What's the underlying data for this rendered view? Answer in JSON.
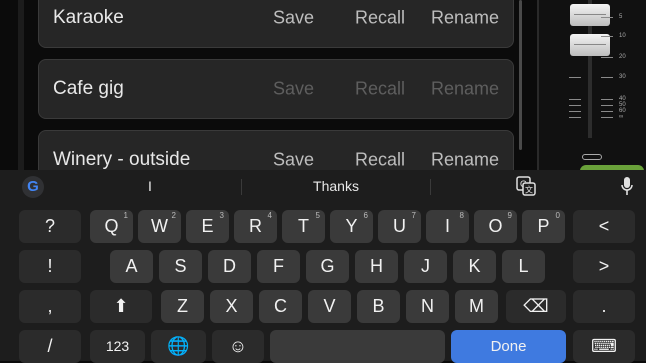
{
  "presets": [
    {
      "name": "Karaoke",
      "save": "Save",
      "recall": "Recall",
      "rename": "Rename",
      "dim": false
    },
    {
      "name": "Cafe gig",
      "save": "Save",
      "recall": "Recall",
      "rename": "Rename",
      "dim": true
    },
    {
      "name": "Winery - outside",
      "save": "Save",
      "recall": "Recall",
      "rename": "Rename",
      "dim": false
    }
  ],
  "fader_scale": [
    "5",
    "10",
    "20",
    "30",
    "40",
    "50",
    "60",
    "∞"
  ],
  "keyboard": {
    "suggestions": [
      "I",
      "Thanks",
      ""
    ],
    "row1": [
      {
        "label": "?",
        "hint": ""
      },
      {
        "label": "Q",
        "hint": "1"
      },
      {
        "label": "W",
        "hint": "2"
      },
      {
        "label": "E",
        "hint": "3"
      },
      {
        "label": "R",
        "hint": "4"
      },
      {
        "label": "T",
        "hint": "5"
      },
      {
        "label": "Y",
        "hint": "6"
      },
      {
        "label": "U",
        "hint": "7"
      },
      {
        "label": "I",
        "hint": "8"
      },
      {
        "label": "O",
        "hint": "9"
      },
      {
        "label": "P",
        "hint": "0"
      },
      {
        "label": "<",
        "hint": ""
      }
    ],
    "row2": [
      {
        "label": "!"
      },
      {
        "label": "A"
      },
      {
        "label": "S"
      },
      {
        "label": "D"
      },
      {
        "label": "F"
      },
      {
        "label": "G"
      },
      {
        "label": "H"
      },
      {
        "label": "J"
      },
      {
        "label": "K"
      },
      {
        "label": "L"
      },
      {
        "label": ">"
      }
    ],
    "row3": [
      {
        "label": ","
      },
      {
        "label": "⬆"
      },
      {
        "label": "Z"
      },
      {
        "label": "X"
      },
      {
        "label": "C"
      },
      {
        "label": "V"
      },
      {
        "label": "B"
      },
      {
        "label": "N"
      },
      {
        "label": "M"
      },
      {
        "label": "⌫"
      },
      {
        "label": "."
      }
    ],
    "row4": {
      "slash": "/",
      "numbers": "123",
      "globe": "🌐",
      "emoji": "☺",
      "space": "",
      "done": "Done",
      "hide": "⌨"
    }
  },
  "icons": {
    "google": "google-icon",
    "translate": "translate-icon",
    "mic": "microphone-icon"
  },
  "colors": {
    "done_key": "#3f7ae0",
    "fader_indicator": "#6aa23a"
  }
}
